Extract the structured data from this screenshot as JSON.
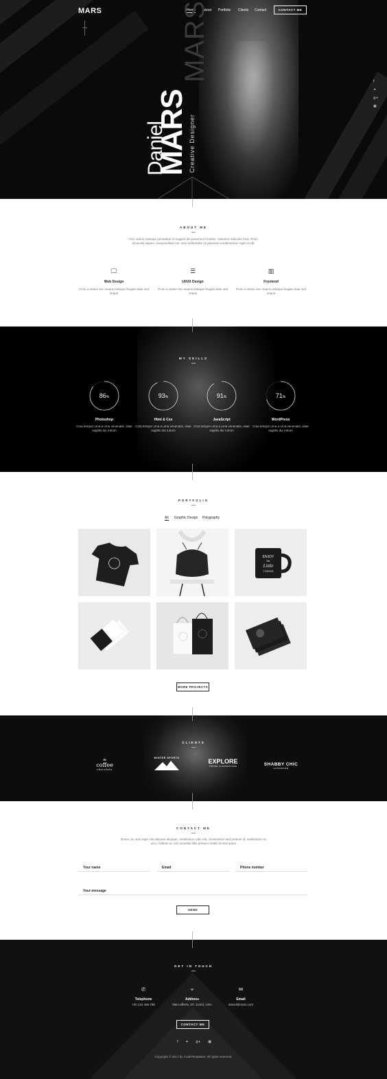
{
  "header": {
    "logo": "MARS",
    "nav": [
      "Home",
      "About",
      "Portfolio",
      "Clients",
      "Contact"
    ],
    "cta": "CONTACT ME"
  },
  "hero": {
    "first_name": "Daniel",
    "last_name": "MARS",
    "role": "Creative Designer",
    "watermark": "MARS",
    "social_icons": [
      "facebook-icon",
      "twitter-icon",
      "google-plus-icon",
      "instagram-icon"
    ]
  },
  "about": {
    "title": "ABOUT ME",
    "text": "Orci varius natoque penatibus et magnis dis parturient montes, nascetur ridiculus mus. Proin id iaculis sapien. Suspendisse nec sem sollicitudin mi placerat condimentum eget et elit.",
    "services": [
      {
        "icon": "monitor-icon",
        "title": "Web Design",
        "text": "Proin a metus nec mauris tristique feugiat vitae sed neque"
      },
      {
        "icon": "wireframe-icon",
        "title": "UI/UX Design",
        "text": "Proin a metus nec mauris tristique feugiat vitae sed neque"
      },
      {
        "icon": "code-icon",
        "title": "Frontend",
        "text": "Proin a metus nec mauris tristique feugiat vitae sed neque"
      }
    ]
  },
  "skills": {
    "title": "MY SKILLS",
    "items": [
      {
        "name": "Photoshop",
        "percent": 86,
        "text": "Cras tempor urna a urna venenatis, vitae sagittis dui rutrum"
      },
      {
        "name": "Html & Css",
        "percent": 93,
        "text": "Cras tempor urna a urna venenatis, vitae sagittis dui rutrum"
      },
      {
        "name": "JavaScript",
        "percent": 91,
        "text": "Cras tempor urna a urna venenatis, vitae sagittis dui rutrum"
      },
      {
        "name": "WordPress",
        "percent": 71,
        "text": "Cras tempor urna a urna venenatis, vitae sagittis dui rutrum"
      }
    ],
    "unit": "%"
  },
  "portfolio": {
    "title": "PORTFOLIO",
    "filters": [
      "All",
      "Graphic Design",
      "Polygraphy"
    ],
    "active_filter": "All",
    "items": [
      "t-shirt",
      "drawstring-bag",
      "coffee-mug",
      "business-cards",
      "shopping-bags",
      "books"
    ],
    "mug_text": [
      "ENJOY",
      "the",
      "Little",
      "THINGS"
    ],
    "more": "MORE PROJECTS"
  },
  "clients": {
    "title": "CLIENTS",
    "logos": [
      {
        "name": "coffee",
        "sub": "chocolate"
      },
      {
        "name": "WINTER SPORTS",
        "sub": ""
      },
      {
        "name": "EXPLORE",
        "sub": "TRAVEL & ADVENTURE"
      },
      {
        "name": "SHABBY CHIC",
        "sub": "HANDMADE"
      }
    ]
  },
  "contact": {
    "title": "CONTACT ME",
    "text": "Donec ac urna eget nisi aliquam aliquam. Vestibulum odio elit, consectetur sed pretium id, vestibulum eu arcu. Nullam ac est convallis felis pretium mattis at sed quam",
    "fields": {
      "name": "Your name",
      "email": "Email",
      "phone": "Phone number",
      "message": "Your message"
    },
    "send": "SEND"
  },
  "footer": {
    "title": "GET IN TOUCH",
    "items": [
      {
        "icon": "phone-icon",
        "label": "Telephone",
        "value": "+00 123 456 789"
      },
      {
        "icon": "location-icon",
        "label": "Address",
        "value": "965 Lefferts, NY 11203, USA"
      },
      {
        "icon": "mail-icon",
        "label": "Email",
        "value": "daniel@mars.com"
      }
    ],
    "cta": "CONTACT ME",
    "social_icons": [
      "facebook-icon",
      "twitter-icon",
      "google-plus-icon",
      "instagram-icon"
    ],
    "copyright": "Copyright © 2017 by CodeTemplates. All rights reserved."
  }
}
